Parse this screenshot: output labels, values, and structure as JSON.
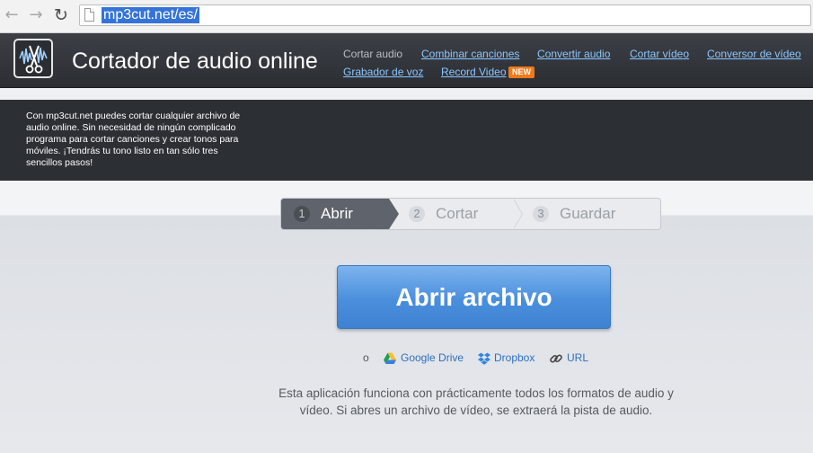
{
  "browser": {
    "back_glyph": "←",
    "forward_glyph": "→",
    "reload_glyph": "↻",
    "url": "mp3cut.net/es/"
  },
  "header": {
    "title": "Cortador de audio online",
    "nav": [
      {
        "label": "Cortar audio",
        "current": true
      },
      {
        "label": "Combinar canciones"
      },
      {
        "label": "Convertir audio"
      },
      {
        "label": "Cortar vídeo"
      },
      {
        "label": "Conversor de vídeo"
      },
      {
        "label": "Grabador de voz"
      },
      {
        "label": "Record Video",
        "badge": "NEW"
      }
    ]
  },
  "hero": {
    "intro": "Con mp3cut.net puedes cortar cualquier archivo de audio online. Sin necesidad de ningún complicado programa para cortar canciones y crear tonos para móviles. ¡Tendrás tu tono listo en tan sólo tres sencillos pasos!"
  },
  "steps": [
    {
      "num": "1",
      "label": "Abrir",
      "active": true
    },
    {
      "num": "2",
      "label": "Cortar"
    },
    {
      "num": "3",
      "label": "Guardar"
    }
  ],
  "main": {
    "open_button": "Abrir archivo",
    "or_text": "o",
    "sources": [
      {
        "icon": "google-drive-icon",
        "label": "Google Drive"
      },
      {
        "icon": "dropbox-icon",
        "label": "Dropbox"
      },
      {
        "icon": "link-icon",
        "label": "URL"
      }
    ],
    "description": "Esta aplicación funciona con prácticamente todos los formatos de audio y vídeo. Si abres un archivo de vídeo, se extraerá la pista de audio."
  },
  "colors": {
    "header_bg": "#2f3237",
    "link": "#8cc6ff",
    "badge": "#f07a1b",
    "primary_button": "#4a8fdc",
    "source_link": "#2f6fbf"
  }
}
